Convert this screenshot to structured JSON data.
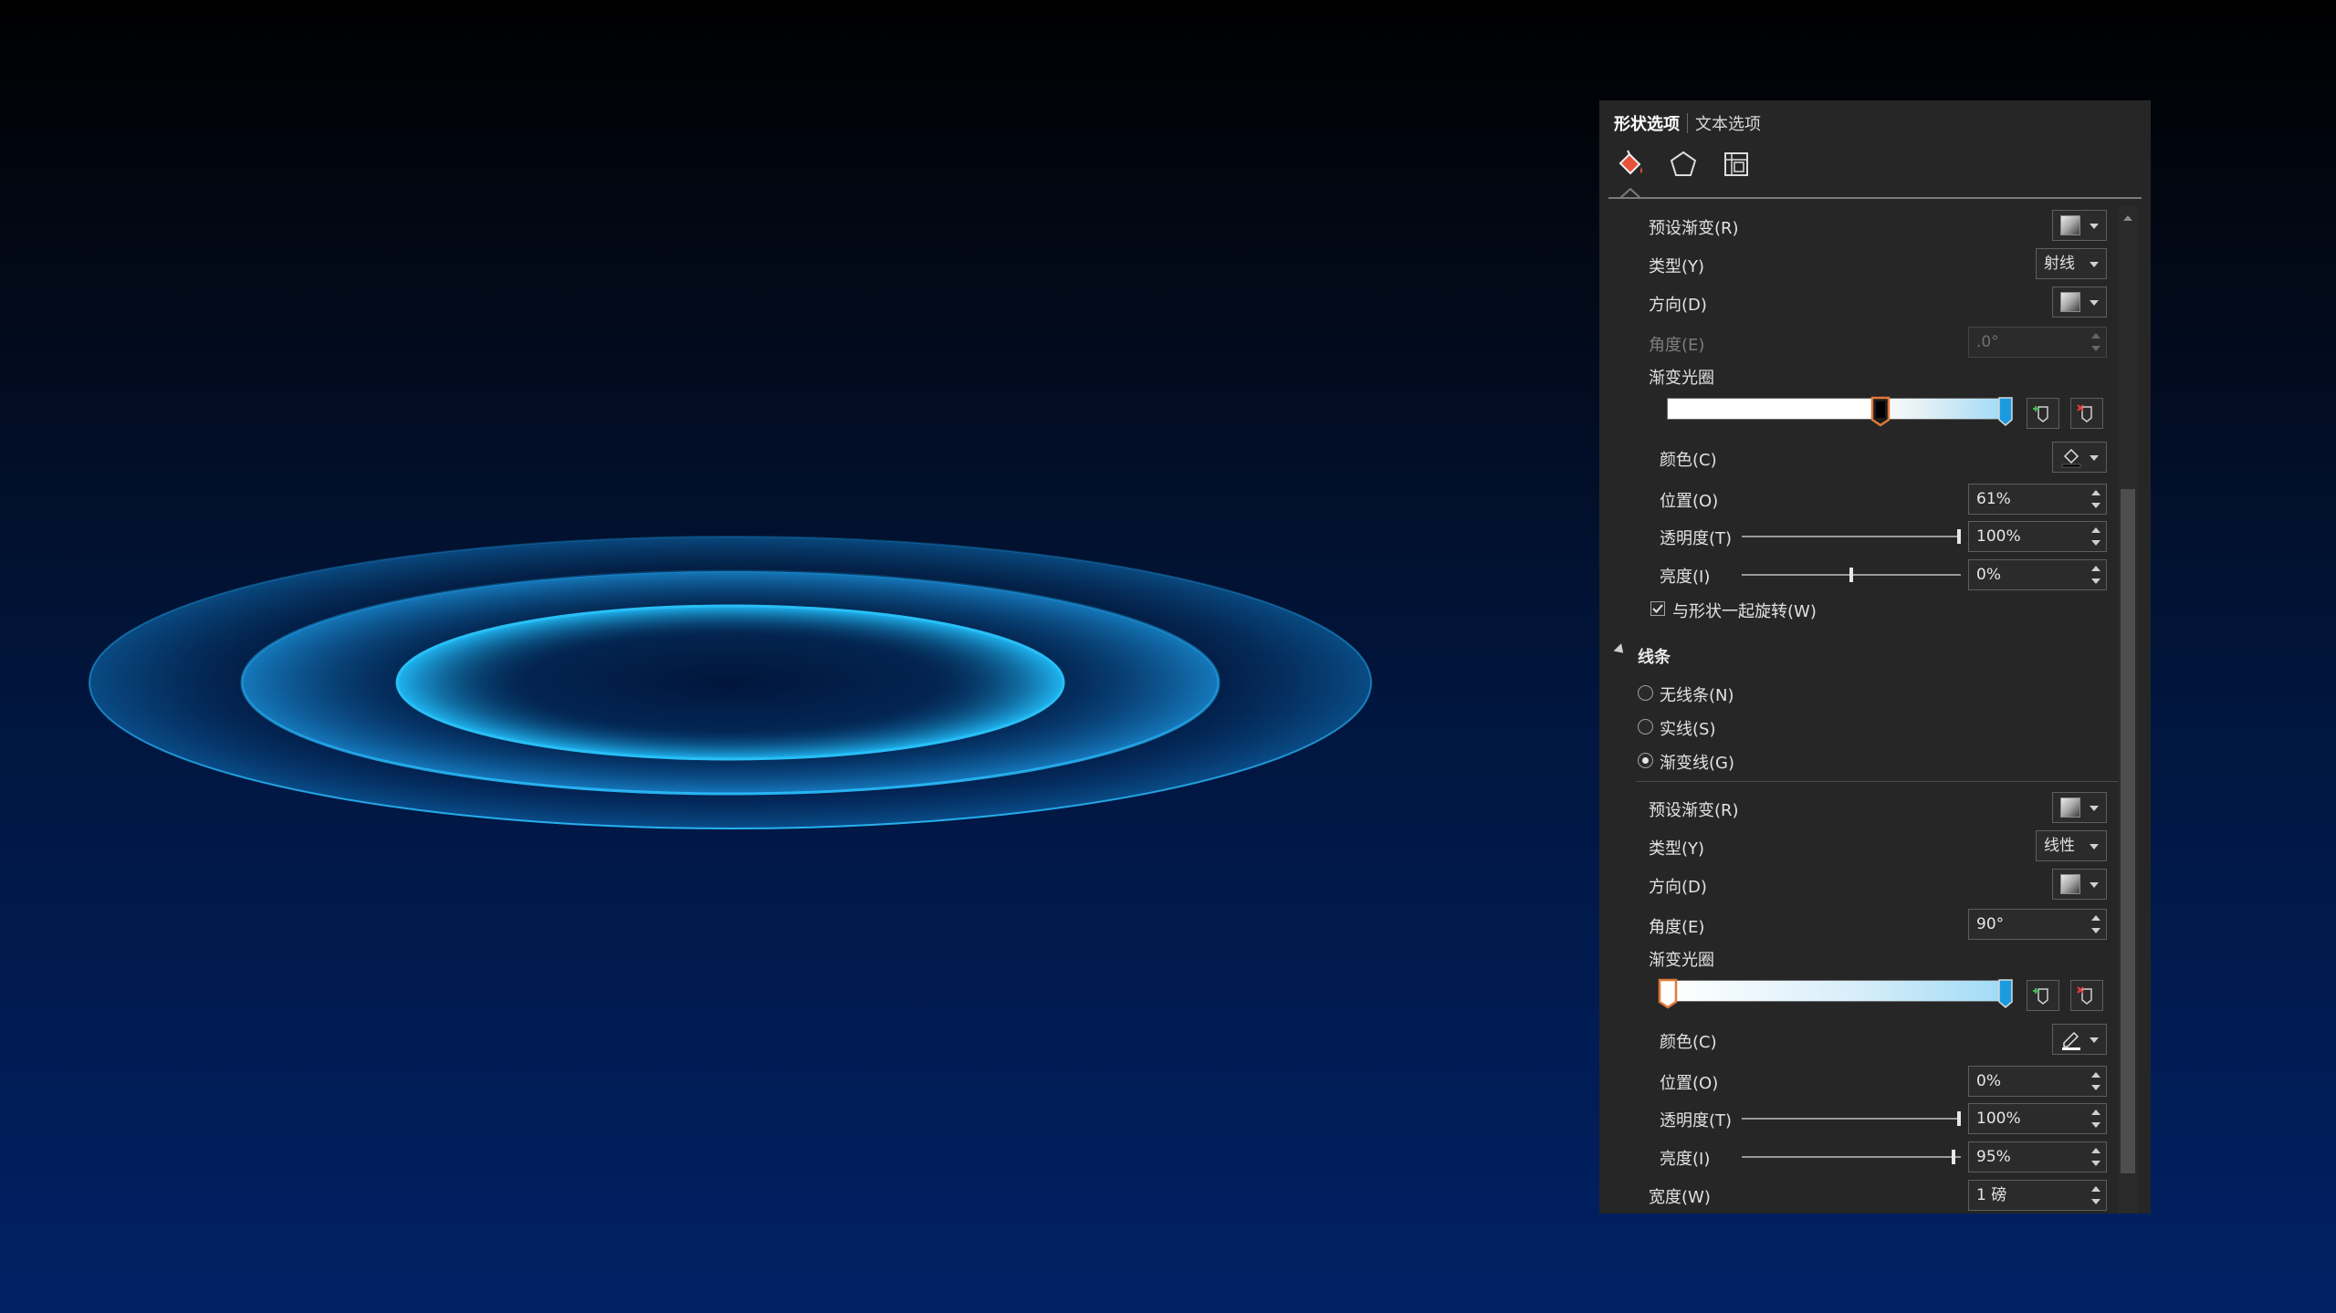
{
  "panel": {
    "tabs": [
      "形状选项",
      "文本选项"
    ],
    "category_icons": [
      "fill-bucket-icon",
      "pentagon-icon",
      "size-properties-icon"
    ]
  },
  "fill": {
    "preset_label": "预设渐变(R)",
    "type_label": "类型(Y)",
    "type_value": "射线",
    "direction_label": "方向(D)",
    "angle_label": "角度(E)",
    "angle_value": ".0°",
    "stops_label": "渐变光圈",
    "color_label": "颜色(C)",
    "position_label": "位置(O)",
    "position_value": "61%",
    "transparency_label": "透明度(T)",
    "transparency_value": "100%",
    "brightness_label": "亮度(I)",
    "brightness_value": "0%",
    "rotate_label": "与形状一起旋转(W)"
  },
  "line": {
    "section_title": "线条",
    "no_line_label": "无线条(N)",
    "solid_label": "实线(S)",
    "gradient_label": "渐变线(G)",
    "preset_label": "预设渐变(R)",
    "type_label": "类型(Y)",
    "type_value": "线性",
    "direction_label": "方向(D)",
    "angle_label": "角度(E)",
    "angle_value": "90°",
    "stops_label": "渐变光圈",
    "color_label": "颜色(C)",
    "position_label": "位置(O)",
    "position_value": "0%",
    "transparency_label": "透明度(T)",
    "transparency_value": "100%",
    "brightness_label": "亮度(I)",
    "brightness_value": "95%",
    "width_label": "宽度(W)",
    "width_value": "1 磅"
  },
  "colors": {
    "accent_blue": "#1a9be0",
    "ring_cyan": "#21b6ef",
    "stop_selected_border": "#e0793a"
  }
}
